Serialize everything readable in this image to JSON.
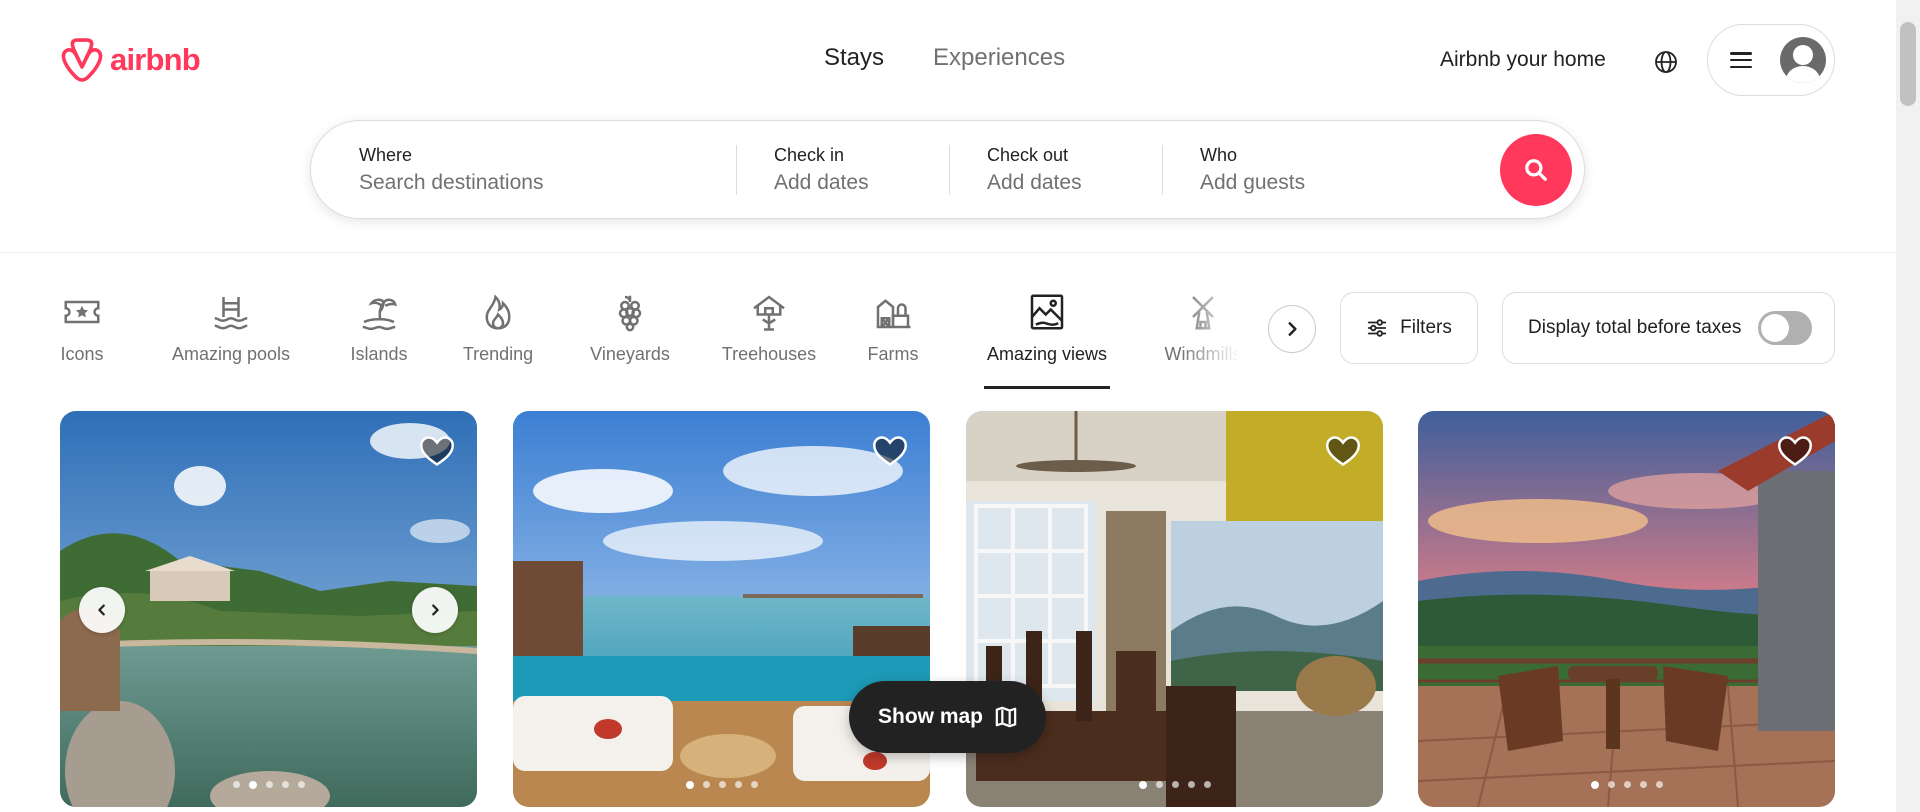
{
  "header": {
    "logo_text": "airbnb",
    "tabs": [
      {
        "label": "Stays",
        "active": true
      },
      {
        "label": "Experiences",
        "active": false
      }
    ],
    "host_link": "Airbnb your home",
    "globe_icon": "globe-icon",
    "menu_icon": "hamburger-icon"
  },
  "search": {
    "where_label": "Where",
    "where_placeholder": "Search destinations",
    "checkin_label": "Check in",
    "checkin_value": "Add dates",
    "checkout_label": "Check out",
    "checkout_value": "Add dates",
    "who_label": "Who",
    "who_value": "Add guests",
    "button_icon": "search-icon"
  },
  "categories": [
    {
      "label": "Icons",
      "icon": "ticket-star-icon",
      "active": false
    },
    {
      "label": "Amazing pools",
      "icon": "pool-icon",
      "active": false
    },
    {
      "label": "Islands",
      "icon": "island-icon",
      "active": false
    },
    {
      "label": "Trending",
      "icon": "flame-icon",
      "active": false
    },
    {
      "label": "Vineyards",
      "icon": "grapes-icon",
      "active": false
    },
    {
      "label": "Treehouses",
      "icon": "treehouse-icon",
      "active": false
    },
    {
      "label": "Farms",
      "icon": "farm-icon",
      "active": false
    },
    {
      "label": "Amazing views",
      "icon": "picture-view-icon",
      "active": true
    },
    {
      "label": "Windmills",
      "icon": "windmill-icon",
      "active": false
    }
  ],
  "filters": {
    "filters_label": "Filters",
    "tax_label": "Display total before taxes",
    "tax_toggle_on": false
  },
  "listings": [
    {
      "photo": "infinity pool overlooking jungle hills",
      "dots": 5,
      "active_dot": 1,
      "arrows": true
    },
    {
      "photo": "private pool villa facing the sea",
      "dots": 5,
      "active_dot": 0,
      "arrows": false
    },
    {
      "photo": "dining room with mountain view windows",
      "dots": 5,
      "active_dot": 0,
      "arrows": false
    },
    {
      "photo": "terrace with chairs at sunset",
      "dots": 5,
      "active_dot": 0,
      "arrows": false
    }
  ],
  "show_map": {
    "label": "Show map",
    "icon": "map-icon"
  },
  "colors": {
    "brand": "#ff385c",
    "text": "#222222",
    "muted": "#717171",
    "border": "#dddddd"
  }
}
